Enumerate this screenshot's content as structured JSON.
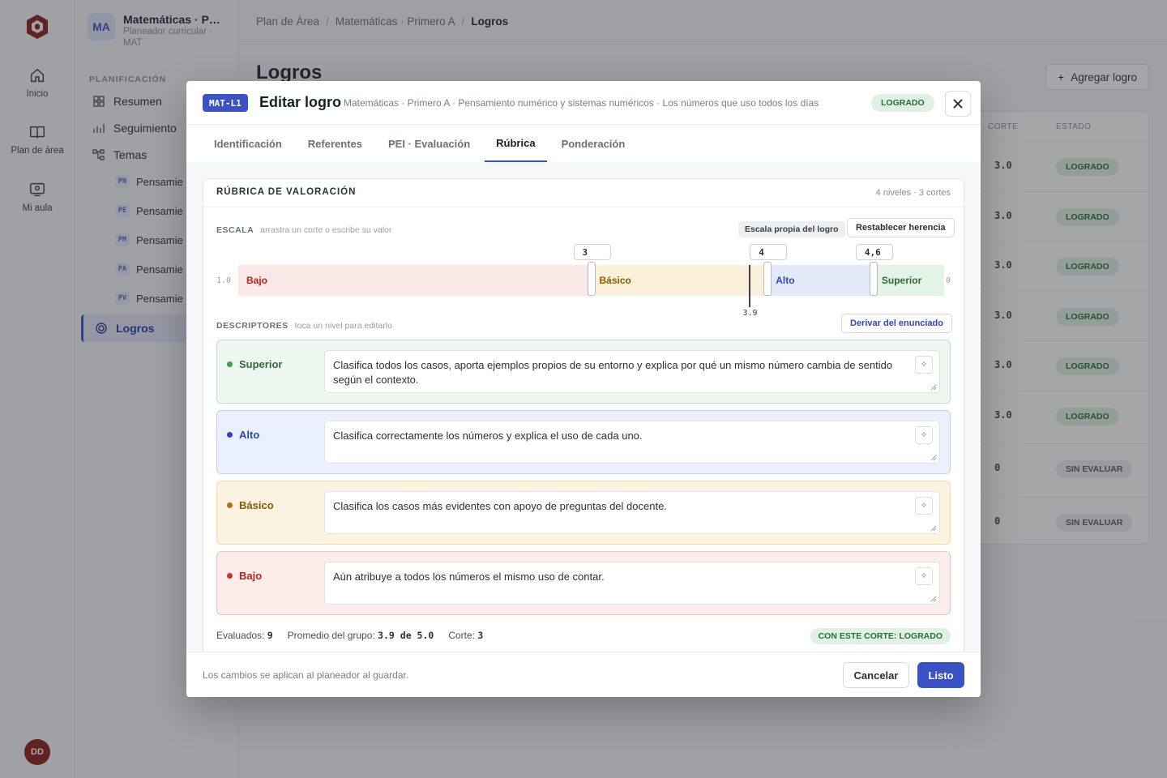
{
  "rail": {
    "items": [
      {
        "label": "Inicio",
        "icon": "home-icon"
      },
      {
        "label": "Plan de área",
        "icon": "book-icon"
      },
      {
        "label": "Mi aula",
        "icon": "classroom-icon"
      }
    ],
    "user_initials": "DD"
  },
  "sidebar": {
    "badge": "MA",
    "title": "Matemáticas · Pr...",
    "subtitle": "Planeador curricular · MAT",
    "section": "PLANIFICACIÓN",
    "items": [
      {
        "label": "Resumen",
        "icon": "grid-icon"
      },
      {
        "label": "Seguimiento",
        "icon": "chart-icon"
      },
      {
        "label": "Temas",
        "icon": "tree-icon"
      }
    ],
    "topics": [
      {
        "code": "PN",
        "label": "Pensamie"
      },
      {
        "code": "PE",
        "label": "Pensamie"
      },
      {
        "code": "PM",
        "label": "Pensamie"
      },
      {
        "code": "PA",
        "label": "Pensamie"
      },
      {
        "code": "PV",
        "label": "Pensamie"
      }
    ],
    "active": "Logros"
  },
  "main": {
    "breadcrumb": [
      "Plan de Área",
      "Matemáticas · Primero A",
      "Logros"
    ],
    "title": "Logros",
    "add_button": "Agregar logro",
    "table_headers": {
      "corte": "CORTE",
      "estado": "ESTADO"
    },
    "rows": [
      {
        "value": "3.0",
        "status": "LOGRADO",
        "kind": "ok"
      },
      {
        "value": "3.0",
        "status": "LOGRADO",
        "kind": "ok"
      },
      {
        "value": "3.0",
        "status": "LOGRADO",
        "kind": "ok"
      },
      {
        "value": "3.0",
        "status": "LOGRADO",
        "kind": "ok"
      },
      {
        "value": "3.0",
        "status": "LOGRADO",
        "kind": "ok"
      },
      {
        "value": "3.0",
        "status": "LOGRADO",
        "kind": "ok"
      },
      {
        "value": "0",
        "status": "SIN EVALUAR",
        "kind": "none"
      },
      {
        "value": "0",
        "status": "SIN EVALUAR",
        "kind": "none"
      }
    ]
  },
  "modal": {
    "code": "MAT-L1",
    "title": "Editar logro",
    "context": "Matemáticas · Primero A · Pensamiento numérico y sistemas numéricos · Los números que uso todos los días",
    "status": "LOGRADO",
    "tabs": [
      "Identificación",
      "Referentes",
      "PEI · Evaluación",
      "Rúbrica",
      "Ponderación"
    ],
    "active_tab": "Rúbrica",
    "rubric": {
      "title": "RÚBRICA DE VALORACIÓN",
      "meta": "4 niveles · 3 cortes",
      "scale_label": "ESCALA",
      "scale_hint": "arrastra un corte o escribe su valor",
      "own_scale_chip": "Escala propia del logro",
      "reset_button": "Restablecer herencia",
      "scale_min": "1.0",
      "scale_max": "0",
      "cuts": [
        "3",
        "4",
        "4,6"
      ],
      "cut_values": [
        3,
        4,
        4.6
      ],
      "range": [
        1,
        5
      ],
      "average": "3.9",
      "average_value": 3.9,
      "levels": [
        {
          "name": "Bajo",
          "bg": "#fbe9e7",
          "fg": "#b3261e"
        },
        {
          "name": "Básico",
          "bg": "#fbf1da",
          "fg": "#8a5a00"
        },
        {
          "name": "Alto",
          "bg": "#e3ebfb",
          "fg": "#2f47b8"
        },
        {
          "name": "Superior",
          "bg": "#e3f3e6",
          "fg": "#2f6a3c"
        }
      ],
      "desc_label": "DESCRIPTORES",
      "desc_hint": "toca un nivel para editarlo",
      "derive_button": "Derivar del enunciado",
      "descriptors": [
        {
          "name": "Superior",
          "text": "Clasifica todos los casos, aporta ejemplos propios de su entorno y explica por qué un mismo número cambia de sentido según el contexto.",
          "bg": "#eef8f0",
          "border": "#bfe0c6",
          "fg": "#2f6a3c",
          "dot": "#3f9a52"
        },
        {
          "name": "Alto",
          "text": "Clasifica correctamente los números y explica el uso de cada uno.",
          "bg": "#eaf0fc",
          "border": "#c3d1f3",
          "fg": "#2f47b8",
          "dot": "#2f47b8"
        },
        {
          "name": "Básico",
          "text": "Clasifica los casos más evidentes con apoyo de preguntas del docente.",
          "bg": "#fcf4e1",
          "border": "#eed9a8",
          "fg": "#8a5a00",
          "dot": "#a8761a"
        },
        {
          "name": "Bajo",
          "text": "Aún atribuye a todos los números el mismo uso de contar.",
          "bg": "#fcecea",
          "border": "#f0c4bf",
          "fg": "#b3261e",
          "dot": "#c0392b"
        }
      ],
      "stats": {
        "evaluated_label": "Evaluados:",
        "evaluated": "9",
        "avg_label": "Promedio del grupo:",
        "avg": "3.9 de 5.0",
        "cut_label": "Corte:",
        "cut": "3"
      },
      "result": "CON ESTE CORTE: LOGRADO"
    },
    "footer_note": "Los cambios se aplican al planeador al guardar.",
    "cancel": "Cancelar",
    "done": "Listo"
  }
}
